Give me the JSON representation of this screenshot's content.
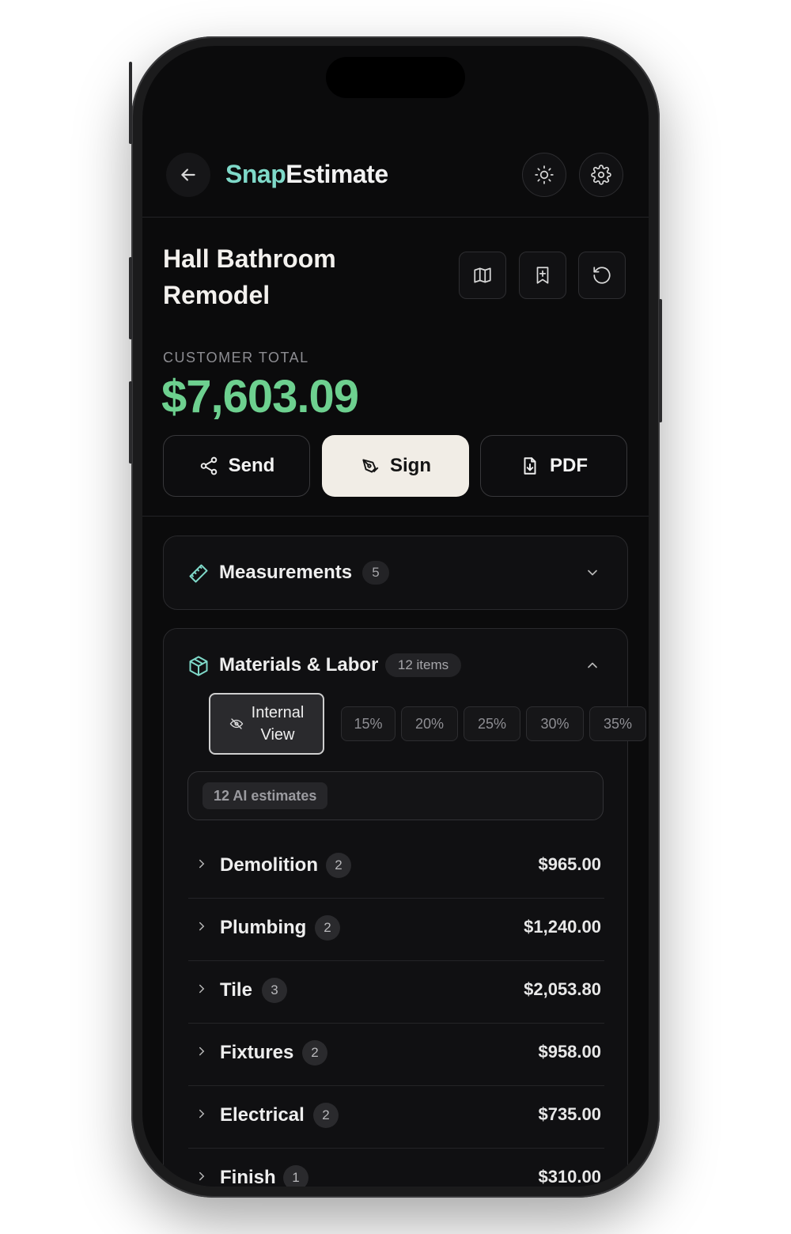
{
  "app": {
    "logo_part1": "Snap",
    "logo_part2": "Estimate"
  },
  "project": {
    "title_line1": "Hall Bathroom",
    "title_line2": "Remodel",
    "total_label": "CUSTOMER TOTAL",
    "total": "$7,603.09"
  },
  "actions": {
    "send": "Send",
    "sign": "Sign",
    "pdf": "PDF"
  },
  "measurements": {
    "title": "Measurements",
    "count": "5"
  },
  "materials": {
    "title": "Materials & Labor",
    "count": "12 items",
    "internal_line1": "Internal",
    "internal_line2": "View",
    "markups": [
      "15%",
      "20%",
      "25%",
      "30%",
      "35%"
    ],
    "ai_badge": "12 AI estimates",
    "categories": [
      {
        "name": "Demolition",
        "count": "2",
        "price": "$965.00"
      },
      {
        "name": "Plumbing",
        "count": "2",
        "price": "$1,240.00"
      },
      {
        "name": "Tile",
        "count": "3",
        "price": "$2,053.80"
      },
      {
        "name": "Fixtures",
        "count": "2",
        "price": "$958.00"
      },
      {
        "name": "Electrical",
        "count": "2",
        "price": "$735.00"
      },
      {
        "name": "Finish",
        "count": "1",
        "price": "$310.00"
      }
    ]
  },
  "colors": {
    "accent_teal": "#7fd9c9",
    "total_green": "#6dd08f",
    "sign_bg": "#f1ede6",
    "background": "#0b0b0c"
  }
}
